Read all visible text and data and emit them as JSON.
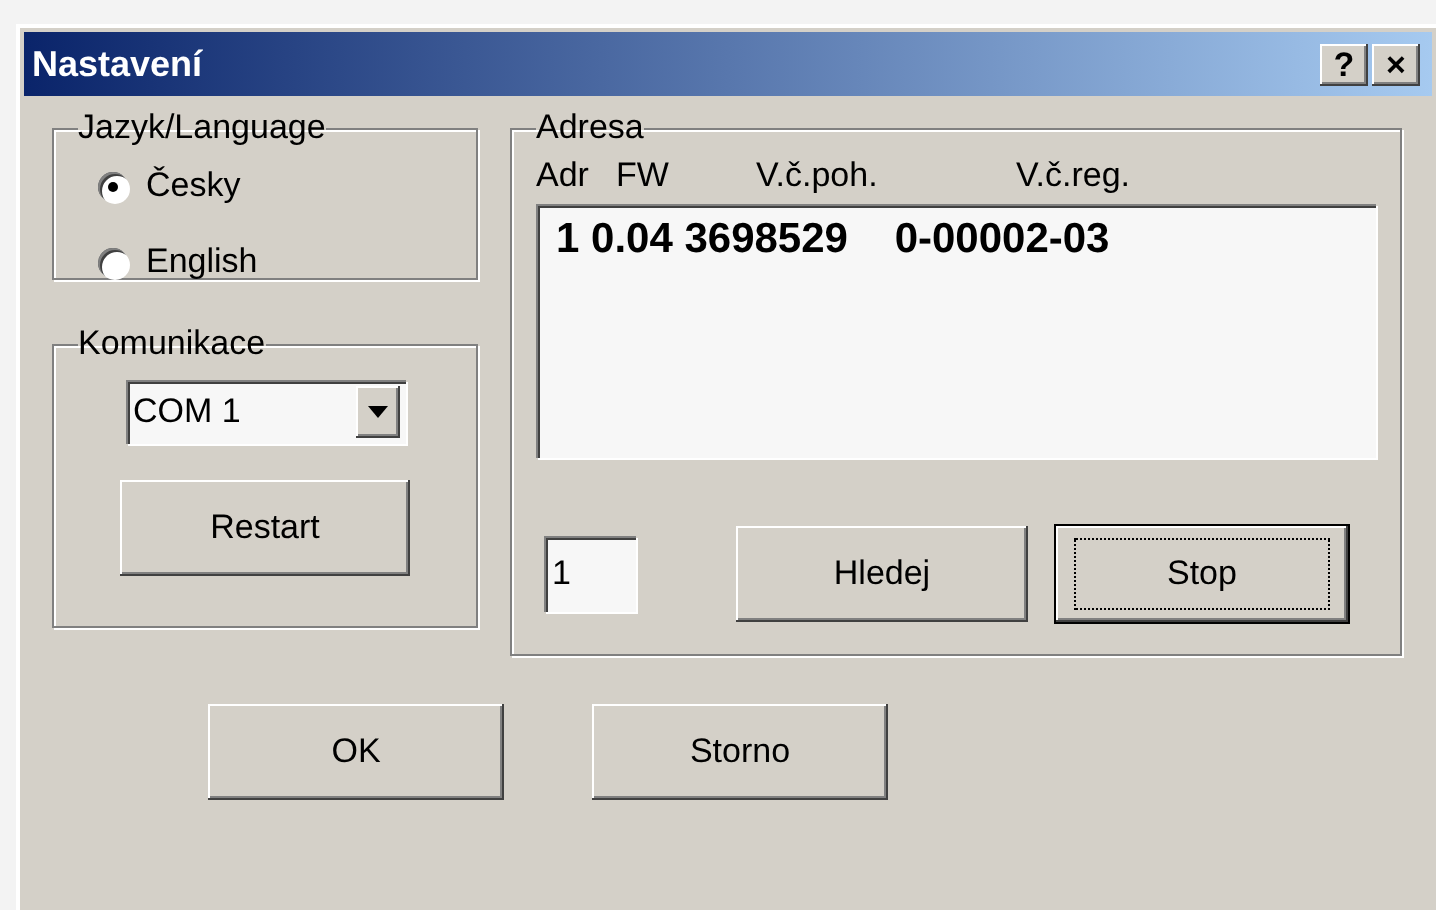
{
  "window": {
    "title": "Nastavení",
    "title_buttons": [
      "?",
      "×"
    ]
  },
  "language": {
    "title": "Jazyk/Language",
    "options": [
      {
        "label": "Česky",
        "selected": true
      },
      {
        "label": "English",
        "selected": false
      }
    ]
  },
  "communication": {
    "title": "Komunikace",
    "port": "COM 1",
    "button": "Restart"
  },
  "address": {
    "title": "Adresa",
    "columns": [
      "Adr",
      "FW",
      "V.č.poh.",
      "V.č.reg."
    ],
    "rows": [
      [
        "1",
        "0.04",
        "3698529",
        "0-00002-03"
      ]
    ],
    "input": "1",
    "buttons": [
      {
        "label": "Hledej",
        "focused": false
      },
      {
        "label": "Stop",
        "focused": true
      }
    ]
  },
  "buttons": [
    "OK",
    "Storno"
  ]
}
